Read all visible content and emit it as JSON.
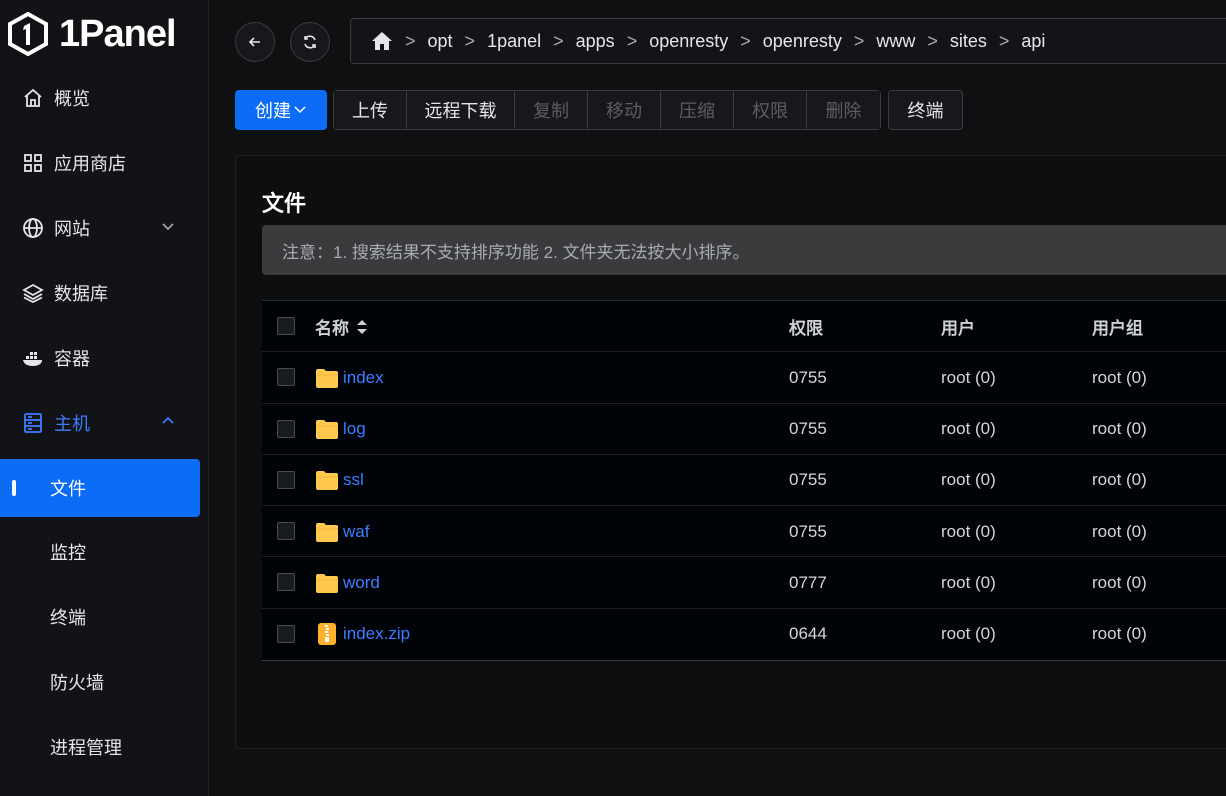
{
  "brand": {
    "name": "1Panel"
  },
  "sidebar": {
    "items": [
      {
        "label": "概览",
        "icon": "home-icon"
      },
      {
        "label": "应用商店",
        "icon": "grid-icon"
      },
      {
        "label": "网站",
        "icon": "globe-icon"
      },
      {
        "label": "数据库",
        "icon": "layers-icon"
      },
      {
        "label": "容器",
        "icon": "docker-icon"
      },
      {
        "label": "主机",
        "icon": "server-icon"
      }
    ],
    "sub_items": [
      {
        "label": "文件",
        "active": true
      },
      {
        "label": "监控"
      },
      {
        "label": "终端"
      },
      {
        "label": "防火墙"
      },
      {
        "label": "进程管理"
      }
    ]
  },
  "breadcrumb": {
    "segments": [
      "opt",
      "1panel",
      "apps",
      "openresty",
      "openresty",
      "www",
      "sites",
      "api"
    ],
    "separator": ">"
  },
  "toolbar": {
    "create_label": "创建",
    "upload_label": "上传",
    "remote_download_label": "远程下载",
    "copy_label": "复制",
    "move_label": "移动",
    "compress_label": "压缩",
    "permission_label": "权限",
    "delete_label": "删除",
    "terminal_label": "终端"
  },
  "card": {
    "title": "文件",
    "notice": "注意：1. 搜索结果不支持排序功能 2. 文件夹无法按大小排序。"
  },
  "table": {
    "headers": {
      "name": "名称",
      "permission": "权限",
      "user": "用户",
      "group": "用户组"
    },
    "rows": [
      {
        "name": "index",
        "type": "folder",
        "permission": "0755",
        "user": "root (0)",
        "group": "root (0)"
      },
      {
        "name": "log",
        "type": "folder",
        "permission": "0755",
        "user": "root (0)",
        "group": "root (0)"
      },
      {
        "name": "ssl",
        "type": "folder",
        "permission": "0755",
        "user": "root (0)",
        "group": "root (0)"
      },
      {
        "name": "waf",
        "type": "folder",
        "permission": "0755",
        "user": "root (0)",
        "group": "root (0)"
      },
      {
        "name": "word",
        "type": "folder",
        "permission": "0777",
        "user": "root (0)",
        "group": "root (0)"
      },
      {
        "name": "index.zip",
        "type": "zip",
        "permission": "0644",
        "user": "root (0)",
        "group": "root (0)"
      }
    ]
  },
  "colors": {
    "accent": "#0c6cf5",
    "link": "#3d7dff",
    "folder": "#ffc94d"
  }
}
